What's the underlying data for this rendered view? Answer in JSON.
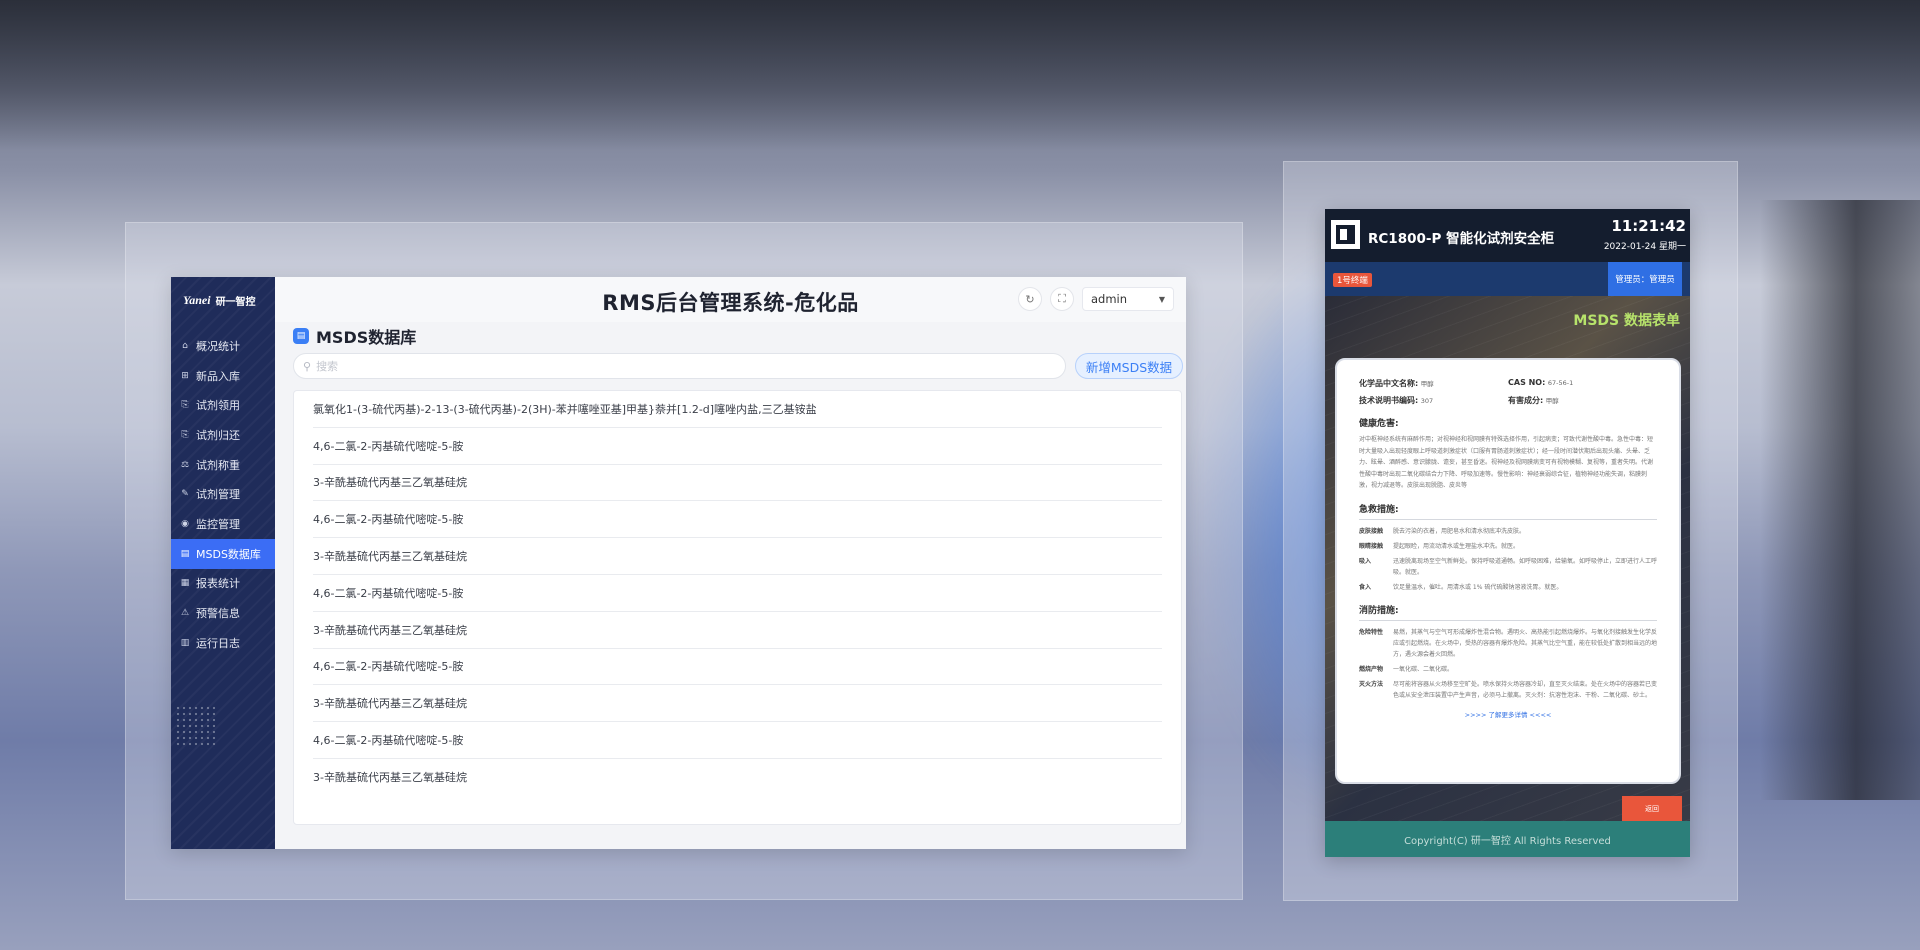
{
  "admin": {
    "logo_mark": "Yanei",
    "logo_text": "研一智控",
    "title": "RMS后台管理系统-危化品",
    "user": "admin",
    "nav": [
      {
        "label": "概况统计",
        "icon": "home-icon",
        "glyph": "⌂"
      },
      {
        "label": "新品入库",
        "icon": "inbox-icon",
        "glyph": "⊞"
      },
      {
        "label": "试剂领用",
        "icon": "export-icon",
        "glyph": "⎘"
      },
      {
        "label": "试剂归还",
        "icon": "return-icon",
        "glyph": "⎘"
      },
      {
        "label": "试剂称重",
        "icon": "scale-icon",
        "glyph": "⚖"
      },
      {
        "label": "试剂管理",
        "icon": "edit-icon",
        "glyph": "✎"
      },
      {
        "label": "监控管理",
        "icon": "camera-icon",
        "glyph": "◉"
      },
      {
        "label": "MSDS数据库",
        "icon": "database-icon",
        "glyph": "▤"
      },
      {
        "label": "报表统计",
        "icon": "report-icon",
        "glyph": "▦"
      },
      {
        "label": "预警信息",
        "icon": "warning-icon",
        "glyph": "⚠"
      },
      {
        "label": "运行日志",
        "icon": "log-icon",
        "glyph": "▥"
      }
    ],
    "section_title": "MSDS数据库",
    "search_placeholder": "搜索",
    "add_button": "新增MSDS数据",
    "items": [
      "氯氧化1-(3-硫代丙基)-2-13-(3-硫代丙基)-2(3H)-苯并噻唑亚基]甲基}萘并[1.2-d]噻唑内盐,三乙基铵盐",
      "4,6-二氯-2-丙基硫代嘧啶-5-胺",
      "3-辛酰基硫代丙基三乙氧基硅烷",
      "4,6-二氯-2-丙基硫代嘧啶-5-胺",
      "3-辛酰基硫代丙基三乙氧基硅烷",
      "4,6-二氯-2-丙基硫代嘧啶-5-胺",
      "3-辛酰基硫代丙基三乙氧基硅烷",
      "4,6-二氯-2-丙基硫代嘧啶-5-胺",
      "3-辛酰基硫代丙基三乙氧基硅烷",
      "4,6-二氯-2-丙基硫代嘧啶-5-胺",
      "3-辛酰基硫代丙基三乙氧基硅烷"
    ]
  },
  "cabinet": {
    "title": "RC1800-P 智能化试剂安全柜",
    "time": "11:21:42",
    "date": "2022-01-24 星期一",
    "line_badge": "1号终端",
    "admin_badge": "管理员：管理员",
    "msds_title": "MSDS 数据表单",
    "fields": {
      "cn_name_key": "化学品中文名称:",
      "cn_name_val": "甲醇",
      "cas_key": "CAS NO:",
      "cas_val": "67-56-1",
      "code_key": "技术说明书编码:",
      "code_val": "307",
      "harm_key": "有害成分:",
      "harm_val": "甲醇"
    },
    "health_title": "健康危害:",
    "health_text": "对中枢神经系统有麻醉作用；对视神经和视网膜有特殊选择作用，引起病变；可致代谢性酸中毒。急性中毒：短时大量吸入出现轻度眼上呼吸道刺激症状（口服有胃肠道刺激症状）；经一段时间潜伏期后出现头痛、头晕、乏力、眩晕、酒醉感、意识朦胧、谵妄，甚至昏迷。视神经及视网膜病变可有视物模糊、复视等，重者失明。代谢性酸中毒时出现二氧化碳结合力下降、呼吸加速等。慢性影响：神经衰弱综合征，植物神经功能失调，粘膜刺激，视力减退等。皮肤出现脱脂、皮炎等",
    "firstaid_title": "急救措施:",
    "firstaid": [
      {
        "k": "皮肤接触",
        "v": "脱去污染的衣着，用肥皂水和清水彻底冲洗皮肤。"
      },
      {
        "k": "眼睛接触",
        "v": "提起眼睑，用流动清水或生理盐水冲洗。就医。"
      },
      {
        "k": "吸入",
        "v": "迅速脱离现场至空气新鲜处。保持呼吸道通畅。如呼吸困难，给输氧。如呼吸停止，立即进行人工呼吸。就医。"
      },
      {
        "k": "食入",
        "v": "饮足量温水，催吐。用清水或 1% 硫代硫酸钠溶液洗胃。就医。"
      }
    ],
    "fire_title": "消防措施:",
    "fire": [
      {
        "k": "危险特性",
        "v": "易燃，其蒸气与空气可形成爆炸性混合物。遇明火、高热能引起燃烧爆炸。与氧化剂接触发生化学反应或引起燃烧。在火场中，受热的容器有爆炸危险。其蒸气比空气重，能在较低处扩散到相当远的地方，遇火源会着火回燃。"
      },
      {
        "k": "燃烧产物",
        "v": "一氧化碳、二氧化碳。"
      },
      {
        "k": "灭火方法",
        "v": "尽可能将容器从火场移至空旷处。喷水保持火场容器冷却，直至灭火结束。处在火场中的容器若已变色或从安全泄压装置中产生声音，必须马上撤离。灭火剂：抗溶性泡沫、干粉、二氧化碳、砂土。"
      }
    ],
    "more_link": ">>>> 了解更多详情 <<<<",
    "return_button": "返回",
    "footer": "Copyright(C) 研一智控 All Rights Reserved"
  }
}
